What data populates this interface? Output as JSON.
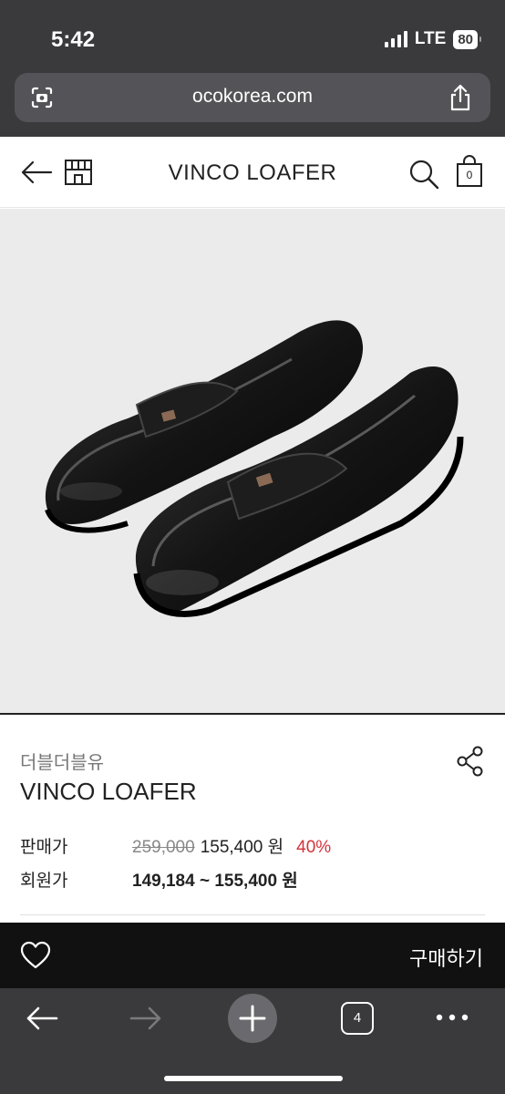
{
  "status_bar": {
    "time": "5:42",
    "network": "LTE",
    "battery": "80"
  },
  "browser": {
    "url": "ocokorea.com"
  },
  "header": {
    "title": "VINCO LOAFER",
    "cart_count": "0"
  },
  "product": {
    "brand": "더블더블유",
    "name": "VINCO LOAFER",
    "sale_price_label": "판매가",
    "original_price": "259,000",
    "sale_price": "155,400 원",
    "discount": "40%",
    "member_price_label": "회원가",
    "member_price": "149,184 ~ 155,400 원"
  },
  "buy_bar": {
    "buy_label": "구매하기"
  },
  "toolbar": {
    "tab_count": "4"
  },
  "colors": {
    "discount": "#d3333a",
    "buy_bar": "#111111",
    "browser_chrome": "#3a3a3c",
    "image_bg": "#ebebeb"
  }
}
